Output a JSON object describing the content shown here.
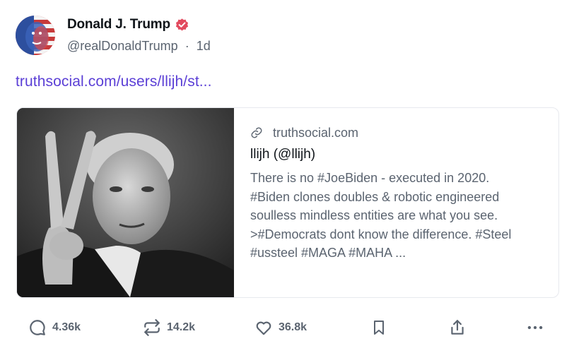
{
  "post": {
    "author_name": "Donald J. Trump",
    "handle": "@realDonaldTrump",
    "separator": "·",
    "age": "1d",
    "link_text": "truthsocial.com/users/llijh/st..."
  },
  "card": {
    "domain": "truthsocial.com",
    "title": "llijh (@llijh)",
    "description": "There is no #JoeBiden - executed in 2020. #Biden clones doubles & robotic engineered soulless mindless entities are what you see. >#Democrats dont know the difference. #Steel #ussteel #MAGA #MAHA ..."
  },
  "actions": {
    "replies": "4.36k",
    "reposts": "14.2k",
    "likes": "36.8k"
  },
  "icons": {
    "verified": "verified-badge-icon",
    "link": "link-icon",
    "reply": "reply-icon",
    "repost": "repost-icon",
    "like": "heart-icon",
    "bookmark": "bookmark-icon",
    "share": "share-icon",
    "more": "more-icon"
  },
  "colors": {
    "link": "#5b3fd6",
    "verified": "#e24a5e",
    "muted": "#5b6470",
    "text": "#0f1419"
  }
}
